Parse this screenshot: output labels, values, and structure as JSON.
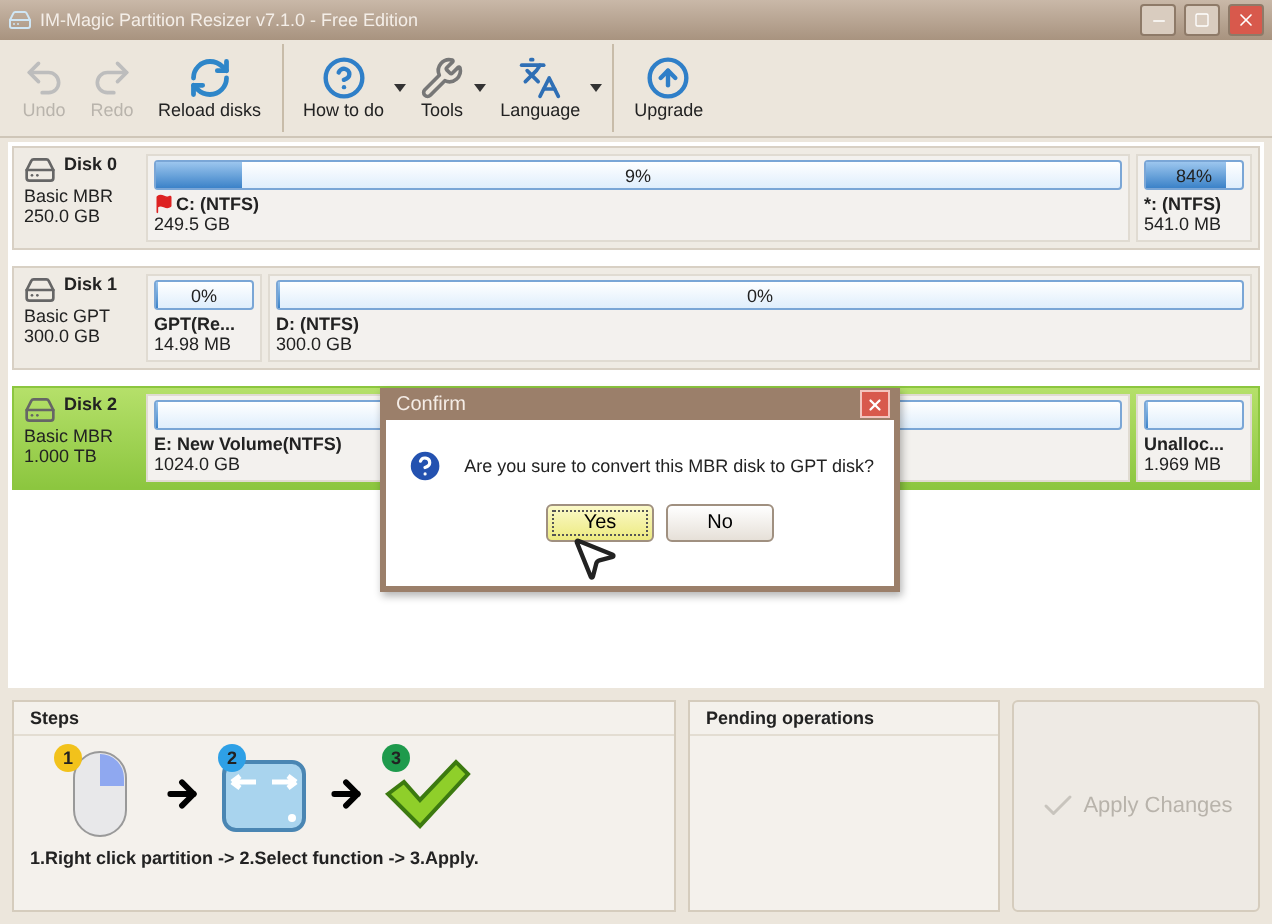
{
  "window": {
    "title": "IM-Magic Partition Resizer v7.1.0 - Free Edition"
  },
  "toolbar": [
    {
      "kind": "undo",
      "label": "Undo",
      "disabled": true,
      "dropdown": false
    },
    {
      "kind": "redo",
      "label": "Redo",
      "disabled": true,
      "dropdown": false
    },
    {
      "kind": "reload",
      "label": "Reload disks",
      "disabled": false,
      "dropdown": false
    },
    {
      "kind": "help",
      "label": "How to do",
      "disabled": false,
      "dropdown": true
    },
    {
      "kind": "tools",
      "label": "Tools",
      "disabled": false,
      "dropdown": true
    },
    {
      "kind": "language",
      "label": "Language",
      "disabled": false,
      "dropdown": true
    },
    {
      "kind": "upgrade",
      "label": "Upgrade",
      "disabled": false,
      "dropdown": false
    }
  ],
  "disks": [
    {
      "name": "Disk 0",
      "type": "Basic MBR",
      "size": "250.0 GB",
      "selected": false,
      "partitions": [
        {
          "kind": "large",
          "usage": "9%",
          "level": 0.09,
          "label": "C: (NTFS)",
          "size": "249.5 GB",
          "system": true
        },
        {
          "kind": "small",
          "usage": "84%",
          "level": 0.84,
          "label": "*: (NTFS)",
          "size": "541.0 MB",
          "system": false
        }
      ]
    },
    {
      "name": "Disk 1",
      "type": "Basic GPT",
      "size": "300.0 GB",
      "selected": false,
      "partitions": [
        {
          "kind": "small",
          "usage": "0%",
          "level": 0,
          "label": "GPT(Re...",
          "size": "14.98 MB",
          "system": false
        },
        {
          "kind": "large",
          "usage": "0%",
          "level": 0,
          "label": "D: (NTFS)",
          "size": "300.0 GB",
          "system": false
        }
      ]
    },
    {
      "name": "Disk 2",
      "type": "Basic MBR",
      "size": "1.000 TB",
      "selected": true,
      "partitions": [
        {
          "kind": "large",
          "level": 0,
          "label": "E: New Volume(NTFS)",
          "size": "1024.0 GB",
          "system": false
        },
        {
          "kind": "small",
          "level": 0,
          "label": "Unalloc...",
          "size": "1.969 MB",
          "system": false
        }
      ]
    }
  ],
  "dialog": {
    "title": "Confirm",
    "message": "Are you sure to convert this MBR disk to GPT disk?",
    "buttons": [
      {
        "label": "Yes",
        "selected": true
      },
      {
        "label": "No",
        "selected": false
      }
    ]
  },
  "steps": {
    "title": "Steps",
    "items": [
      {
        "number": "1",
        "kind": "mouse"
      },
      {
        "number": "2",
        "kind": "drive"
      },
      {
        "number": "3",
        "kind": "check"
      }
    ],
    "caption": "1.Right click partition -> 2.Select function -> 3.Apply."
  },
  "pending": {
    "title": "Pending operations"
  },
  "apply": {
    "label": "Apply Changes",
    "disabled": true
  }
}
